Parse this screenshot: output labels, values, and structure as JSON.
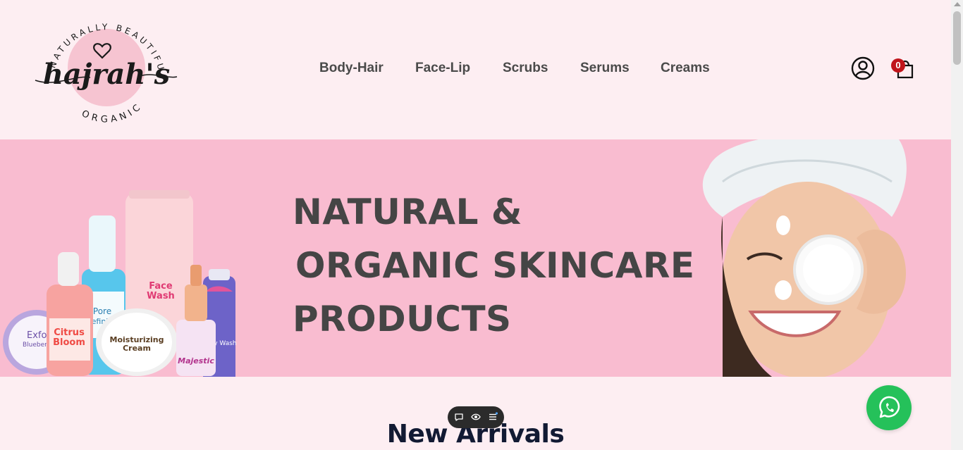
{
  "brand": {
    "name": "hajrah's",
    "tagline_top": "NATURALLY BEAUTIFUL",
    "tagline_bottom": "ORGANIC"
  },
  "nav": {
    "items": [
      {
        "label": "Body-Hair"
      },
      {
        "label": "Face-Lip"
      },
      {
        "label": "Scrubs"
      },
      {
        "label": "Serums"
      },
      {
        "label": "Creams"
      }
    ]
  },
  "header": {
    "account_icon": "user-circle-icon",
    "cart_icon": "shopping-bag-icon",
    "cart_count": "0"
  },
  "hero": {
    "line1": "NATURAL &",
    "line2": "ORGANIC SKINCARE",
    "line3": "PRODUCTS",
    "background_color": "#f9bcd0",
    "product_labels": {
      "scrub": "Exfol",
      "scrub_sub": "Blueberr",
      "citrus": "Citrus",
      "citrus_sub": "Bloom",
      "pore": "Pore",
      "pore_sub": "efinin",
      "face_wash": "Face",
      "face_wash_sub": "Wash",
      "cream": "Moisturizing",
      "cream_sub": "Cream",
      "serum": "Majestic",
      "body_wash": "ody Wash"
    }
  },
  "section": {
    "title": "New Arrivals"
  },
  "floating_toolbar": {
    "icons": [
      "chat-icon",
      "eye-icon",
      "menu-icon"
    ]
  },
  "whatsapp": {
    "icon": "whatsapp-icon",
    "color": "#25c15a"
  }
}
